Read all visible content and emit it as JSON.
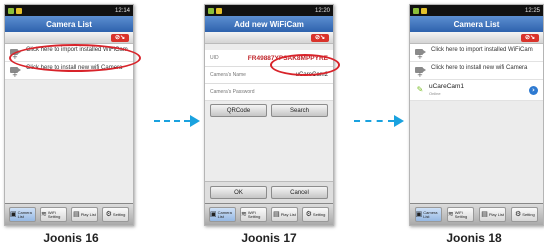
{
  "status_bar": {
    "time1": "12:14",
    "time2": "12:20",
    "time3": "12:25"
  },
  "screen1": {
    "title": "Camera List",
    "items": [
      {
        "text": "Click here to import installed WiFiCam"
      },
      {
        "text": "Click here to install new wifi Camera"
      }
    ],
    "caption": "Joonis 16"
  },
  "screen2": {
    "title": "Add new WiFiCam",
    "uid_label": "UID",
    "uid_value": "FR49887YPSAK8MPPYRE",
    "name_label": "Camera's Name",
    "name_value": "uCareCam2",
    "password_label": "Camera's Password",
    "qrcode_button": "QRCode",
    "search_button": "Search",
    "ok_button": "OK",
    "cancel_button": "Cancel",
    "caption": "Joonis 17"
  },
  "screen3": {
    "title": "Camera List",
    "items": [
      {
        "text": "Click here to import installed WiFiCam"
      },
      {
        "text": "Click here to install new wifi Camera"
      }
    ],
    "camera_name": "uCareCam1",
    "camera_status": "Online",
    "caption": "Joonis 18"
  },
  "bottom_tabs": [
    {
      "label": "Camera List",
      "icon": "camera-icon"
    },
    {
      "label": "WiFi Setting",
      "icon": "wifi-icon"
    },
    {
      "label": "Play List",
      "icon": "film-icon"
    },
    {
      "label": "Setting",
      "icon": "gear-icon"
    }
  ],
  "colors": {
    "accent": "#2e62ad",
    "highlight": "#d8232a",
    "arrow": "#1aa2df"
  }
}
